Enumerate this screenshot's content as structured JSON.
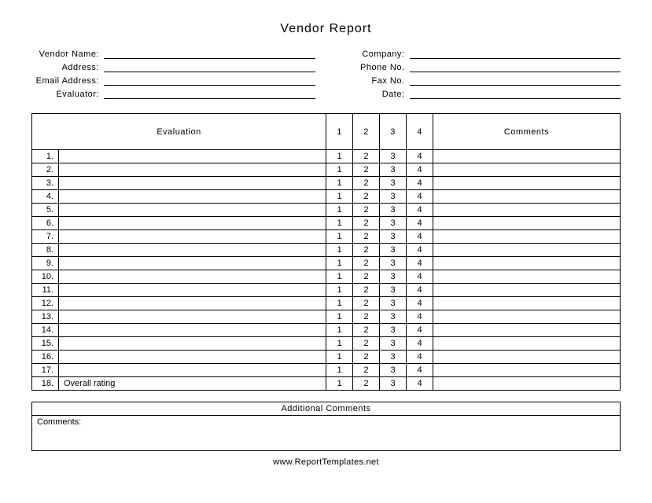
{
  "title": "Vendor Report",
  "headerLeft": [
    {
      "label": "Vendor Name:"
    },
    {
      "label": "Address:"
    },
    {
      "label": "Email Address:"
    },
    {
      "label": "Evaluator:"
    }
  ],
  "headerRight": [
    {
      "label": "Company:"
    },
    {
      "label": "Phone No."
    },
    {
      "label": "Fax No."
    },
    {
      "label": "Date:"
    }
  ],
  "table": {
    "headers": {
      "evaluation": "Evaluation",
      "r1": "1",
      "r2": "2",
      "r3": "3",
      "r4": "4",
      "comments": "Comments"
    },
    "rows": [
      {
        "num": "1.",
        "label": "",
        "r1": "1",
        "r2": "2",
        "r3": "3",
        "r4": "4"
      },
      {
        "num": "2.",
        "label": "",
        "r1": "1",
        "r2": "2",
        "r3": "3",
        "r4": "4"
      },
      {
        "num": "3.",
        "label": "",
        "r1": "1",
        "r2": "2",
        "r3": "3",
        "r4": "4"
      },
      {
        "num": "4.",
        "label": "",
        "r1": "1",
        "r2": "2",
        "r3": "3",
        "r4": "4"
      },
      {
        "num": "5.",
        "label": "",
        "r1": "1",
        "r2": "2",
        "r3": "3",
        "r4": "4"
      },
      {
        "num": "6.",
        "label": "",
        "r1": "1",
        "r2": "2",
        "r3": "3",
        "r4": "4"
      },
      {
        "num": "7.",
        "label": "",
        "r1": "1",
        "r2": "2",
        "r3": "3",
        "r4": "4"
      },
      {
        "num": "8.",
        "label": "",
        "r1": "1",
        "r2": "2",
        "r3": "3",
        "r4": "4"
      },
      {
        "num": "9.",
        "label": "",
        "r1": "1",
        "r2": "2",
        "r3": "3",
        "r4": "4"
      },
      {
        "num": "10.",
        "label": "",
        "r1": "1",
        "r2": "2",
        "r3": "3",
        "r4": "4"
      },
      {
        "num": "11.",
        "label": "",
        "r1": "1",
        "r2": "2",
        "r3": "3",
        "r4": "4"
      },
      {
        "num": "12.",
        "label": "",
        "r1": "1",
        "r2": "2",
        "r3": "3",
        "r4": "4"
      },
      {
        "num": "13.",
        "label": "",
        "r1": "1",
        "r2": "2",
        "r3": "3",
        "r4": "4"
      },
      {
        "num": "14.",
        "label": "",
        "r1": "1",
        "r2": "2",
        "r3": "3",
        "r4": "4"
      },
      {
        "num": "15.",
        "label": "",
        "r1": "1",
        "r2": "2",
        "r3": "3",
        "r4": "4"
      },
      {
        "num": "16.",
        "label": "",
        "r1": "1",
        "r2": "2",
        "r3": "3",
        "r4": "4"
      },
      {
        "num": "17.",
        "label": "",
        "r1": "1",
        "r2": "2",
        "r3": "3",
        "r4": "4"
      },
      {
        "num": "18.",
        "label": "Overall rating",
        "r1": "1",
        "r2": "2",
        "r3": "3",
        "r4": "4"
      }
    ]
  },
  "additional": {
    "heading": "Additional Comments",
    "label": "Comments:"
  },
  "footer": "www.ReportTemplates.net"
}
